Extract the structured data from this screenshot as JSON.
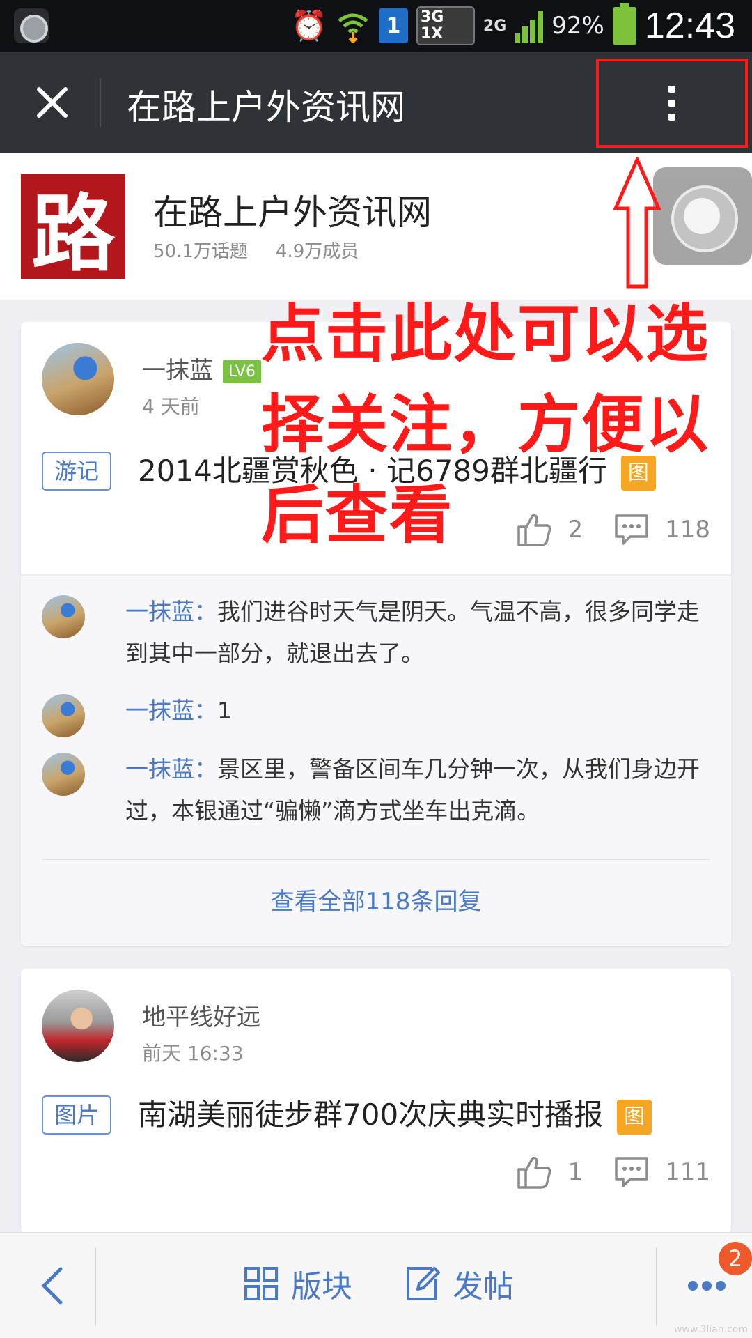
{
  "status_bar": {
    "network_sim": "1",
    "network_type": "3G\n1X",
    "network_2g": "2G",
    "battery": "92%",
    "time": "12:43",
    "colors": {
      "battery": "#7cc23a",
      "sim": "#1f6fc9"
    }
  },
  "titlebar": {
    "title": "在路上户外资讯网",
    "close_icon": "close-icon",
    "more_icon": "more-vertical-icon"
  },
  "forum": {
    "logo_text": "路",
    "name": "在路上户外资讯网",
    "topics": "50.1万话题",
    "members": "4.9万成员"
  },
  "annotation": {
    "text": "点击此处可以选择关注，方便以后查看",
    "color": "#ff1a1a"
  },
  "posts": [
    {
      "author": "一抹蓝",
      "level": "LV6",
      "time": "4 天前",
      "tag": "游记",
      "title": "2014北疆赏秋色 · 记6789群北疆行",
      "image_badge": "图",
      "likes": "2",
      "comments": "118",
      "replies": [
        {
          "name": "一抹蓝：",
          "text": "我们进谷时天气是阴天。气温不高，很多同学走到其中一部分，就退出去了。"
        },
        {
          "name": "一抹蓝：",
          "text": "1"
        },
        {
          "name": "一抹蓝：",
          "text": "景区里，警备区间车几分钟一次，从我们身边开过，本银通过“骗懒”滴方式坐车出克滴。"
        }
      ],
      "view_all": "查看全部118条回复"
    },
    {
      "author": "地平线好远",
      "time": "前天 16:33",
      "tag": "图片",
      "title": "南湖美丽徒步群700次庆典实时播报",
      "image_badge": "图",
      "likes": "1",
      "comments": "111"
    }
  ],
  "bottombar": {
    "sections_label": "版块",
    "post_label": "发帖",
    "notification_count": "2",
    "accent": "#4a7ac6"
  },
  "watermark": "www.3lian.com"
}
